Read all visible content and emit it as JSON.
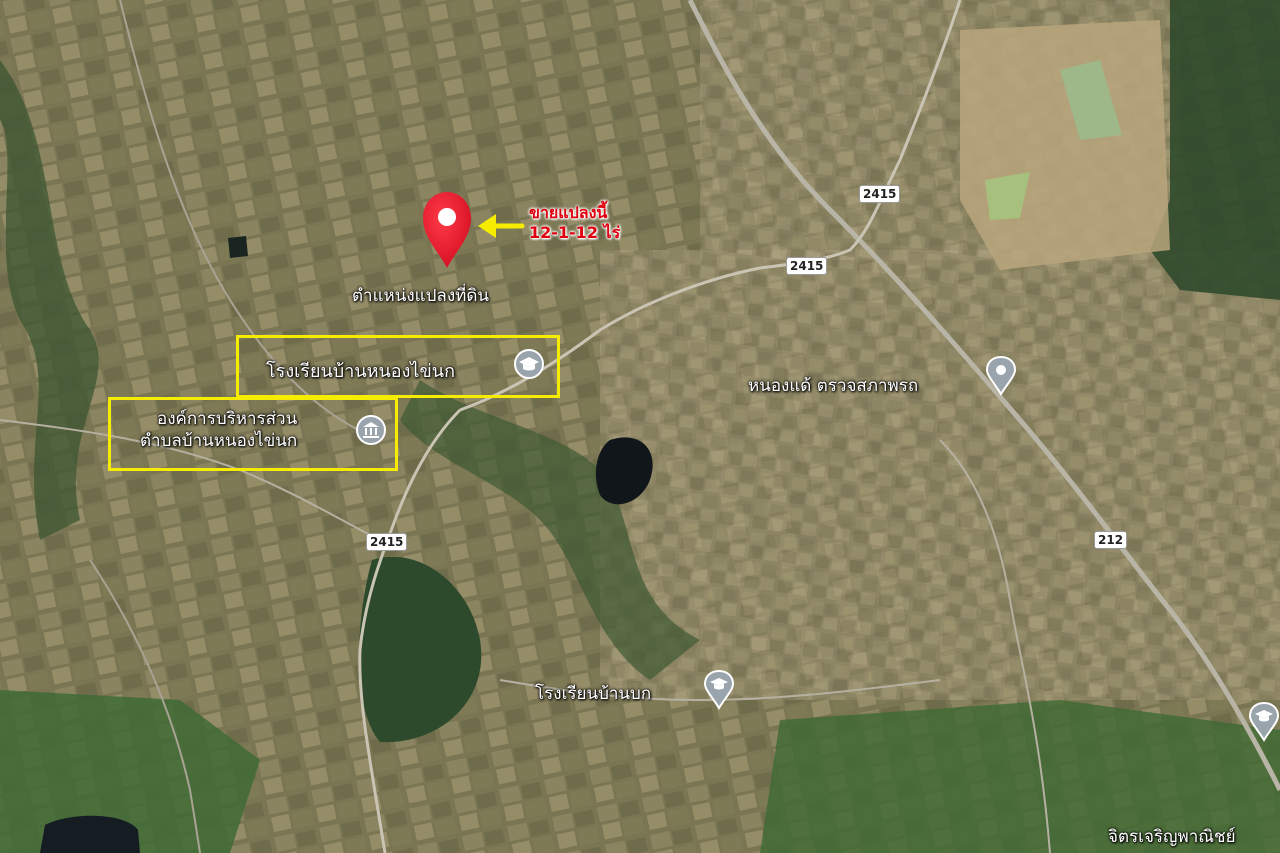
{
  "map": {
    "type": "satellite",
    "roads": [
      "2415",
      "2415",
      "2415",
      "212"
    ],
    "listing_annotation": {
      "line1": "ขายแปลงนี้",
      "line2": "12-1-12 ไร่"
    },
    "pin_label": "ตำแหน่งแปลงที่ดิน",
    "places": [
      {
        "name": "โรงเรียนบ้านหนองไข่นก",
        "icon": "school-icon"
      },
      {
        "line1": "องค์การบริหารส่วน",
        "line2": "ตำบลบ้านหนองไข่นก",
        "icon": "government-building-icon"
      },
      {
        "name": "หนองแด้ ตรวจสภาพรถ",
        "icon": "pin-icon"
      },
      {
        "name": "โรงเรียนบ้านบก",
        "icon": "school-icon"
      },
      {
        "name": "จิตรเจริญพาณิชย์",
        "icon": "school-icon"
      }
    ],
    "colors": {
      "pin": "#e8142a",
      "arrow": "#f5ec00",
      "highlight_box": "#f5ec00",
      "annotation_text": "#e00010"
    }
  }
}
